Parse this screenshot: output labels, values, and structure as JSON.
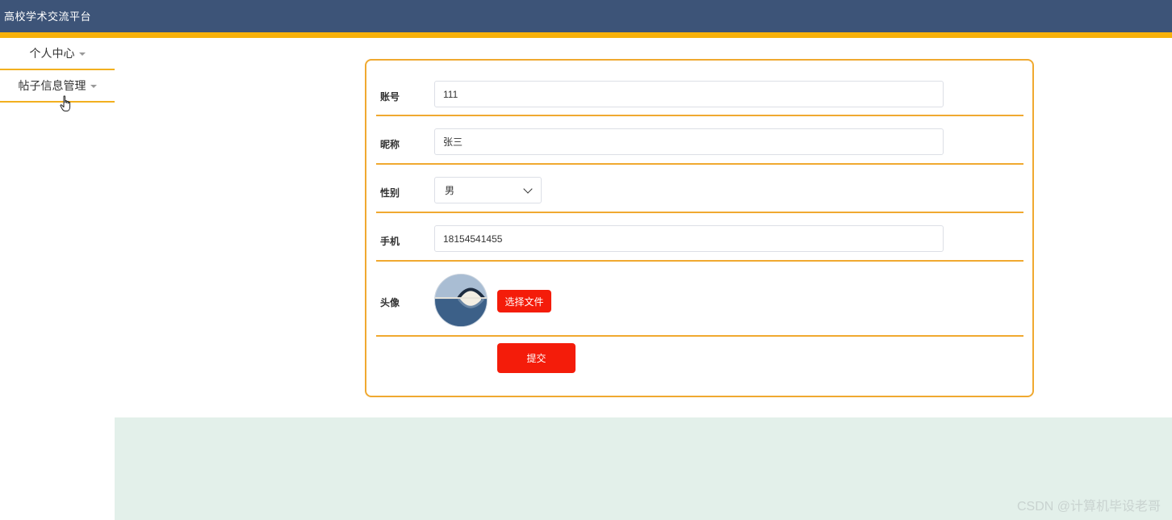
{
  "app": {
    "title": "高校学术交流平台"
  },
  "sidebar": {
    "items": [
      {
        "label": "个人中心"
      },
      {
        "label": "帖子信息管理"
      }
    ]
  },
  "form": {
    "account": {
      "label": "账号",
      "value": "111"
    },
    "nickname": {
      "label": "昵称",
      "value": "张三"
    },
    "gender": {
      "label": "性别",
      "value": "男"
    },
    "phone": {
      "label": "手机",
      "value": "18154541455"
    },
    "avatar": {
      "label": "头像",
      "choose_file_label": "选择文件"
    },
    "submit_label": "提交"
  },
  "watermark": "CSDN @计算机毕设老哥",
  "colors": {
    "header": "#3d5478",
    "accent": "#f7b10a",
    "border": "#f0a930",
    "button": "#f41c0a",
    "panel": "#e3f0ea"
  },
  "icons": {
    "cursor": "hand-pointer-icon",
    "caret": "caret-down-icon",
    "select": "chevron-down-icon"
  }
}
